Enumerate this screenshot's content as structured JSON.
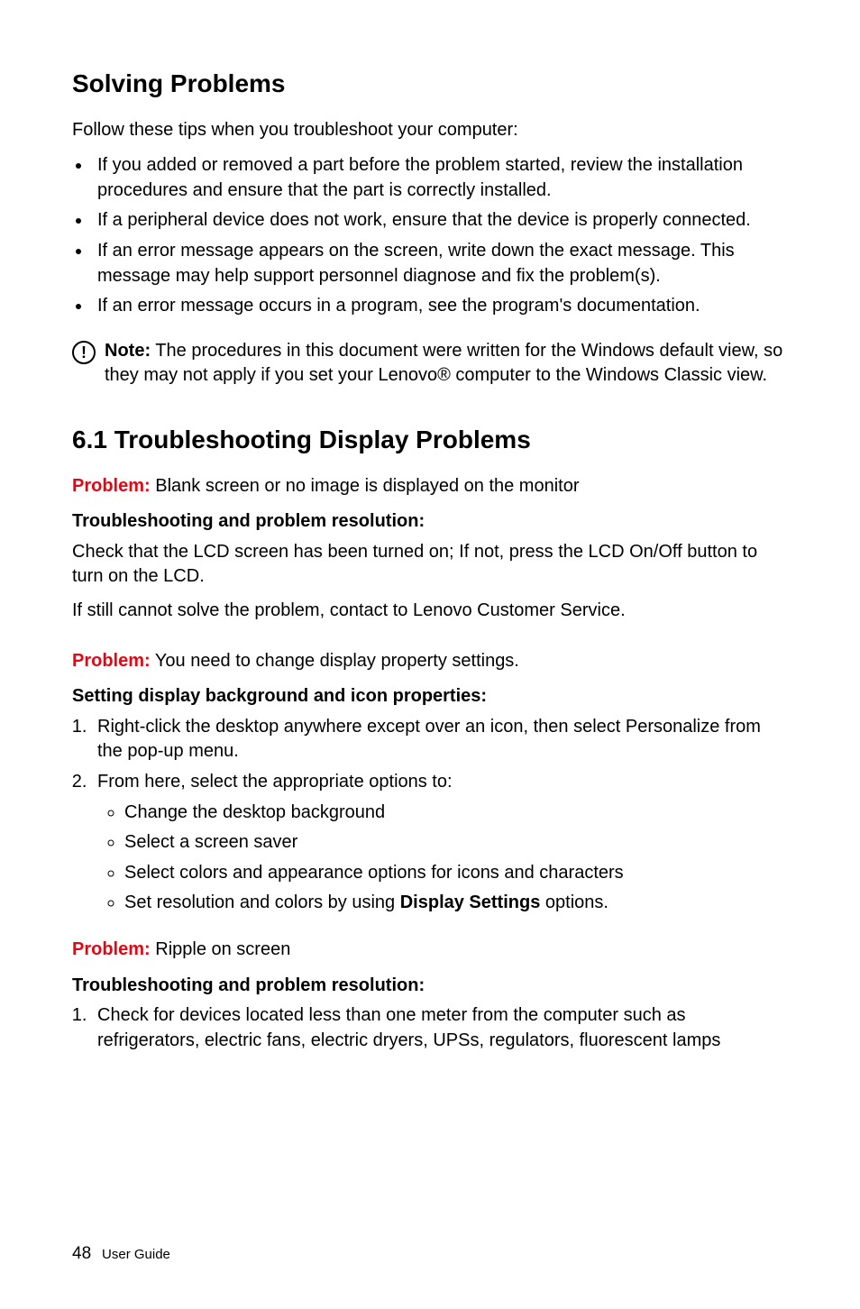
{
  "heading1": "Solving Problems",
  "intro": "Follow these tips when you troubleshoot your computer:",
  "bullets": [
    "If you added or removed a part before the problem started, review the installation procedures and ensure that the part is correctly installed.",
    "If a peripheral device does not work, ensure that the device is properly connected.",
    "If an error message appears on the screen, write down the exact message. This message may help support personnel diagnose and fix the problem(s).",
    "If an error message occurs in a program, see the program's documentation."
  ],
  "note": {
    "label": "Note:",
    "text": " The procedures in this document were written for the Windows default view, so they may not apply if you set your Lenovo® computer to the Windows Classic view."
  },
  "heading2": "6.1 Troubleshooting Display Problems",
  "p1": {
    "label": "Problem:",
    "text": " Blank screen or no image is displayed on the monitor"
  },
  "sub1": "Troubleshooting and problem resolution:",
  "body1": "Check that the LCD screen has been turned on; If not, press the LCD On/Off button to turn on the LCD.",
  "body2": "If still cannot solve the problem, contact to Lenovo Customer Service.",
  "p2": {
    "label": "Problem:",
    "text": " You need to change display property settings."
  },
  "sub2": "Setting display background and icon properties:",
  "steps": [
    "Right-click the desktop anywhere except over an icon, then select Personalize from the pop-up menu.",
    "From here, select the appropriate options to:"
  ],
  "sub_bullets": [
    {
      "text": "Change the desktop background"
    },
    {
      "text": "Select a screen saver"
    },
    {
      "text": "Select colors and appearance options for icons and characters"
    },
    {
      "prefix": "Set resolution and colors by using ",
      "bold": "Display Settings",
      "suffix": " options."
    }
  ],
  "p3": {
    "label": "Problem:",
    "text": " Ripple on screen"
  },
  "sub3": "Troubleshooting and problem resolution:",
  "steps3": [
    "Check for devices located less than one meter from the computer such as refrigerators, electric fans, electric dryers, UPSs, regulators, fluorescent lamps"
  ],
  "footer": {
    "page": "48",
    "label": "User Guide"
  }
}
